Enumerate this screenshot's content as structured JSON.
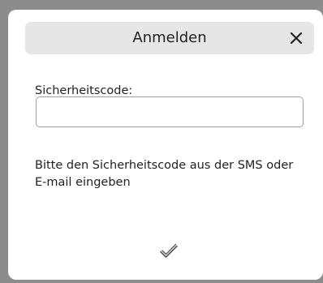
{
  "dialog": {
    "title": "Anmelden",
    "close_icon": "close-icon",
    "field_label": "Sicherheitscode:",
    "field_value": "",
    "field_placeholder": "",
    "hint": "Bitte den Sicherheitscode aus der SMS oder E-mail eingeben",
    "confirm_icon": "checkmark-icon"
  },
  "colors": {
    "backdrop": "#8c8c8c",
    "titlebar": "#e6e6e6",
    "dialog": "#ffffff",
    "input_border": "#9e9e9e"
  }
}
